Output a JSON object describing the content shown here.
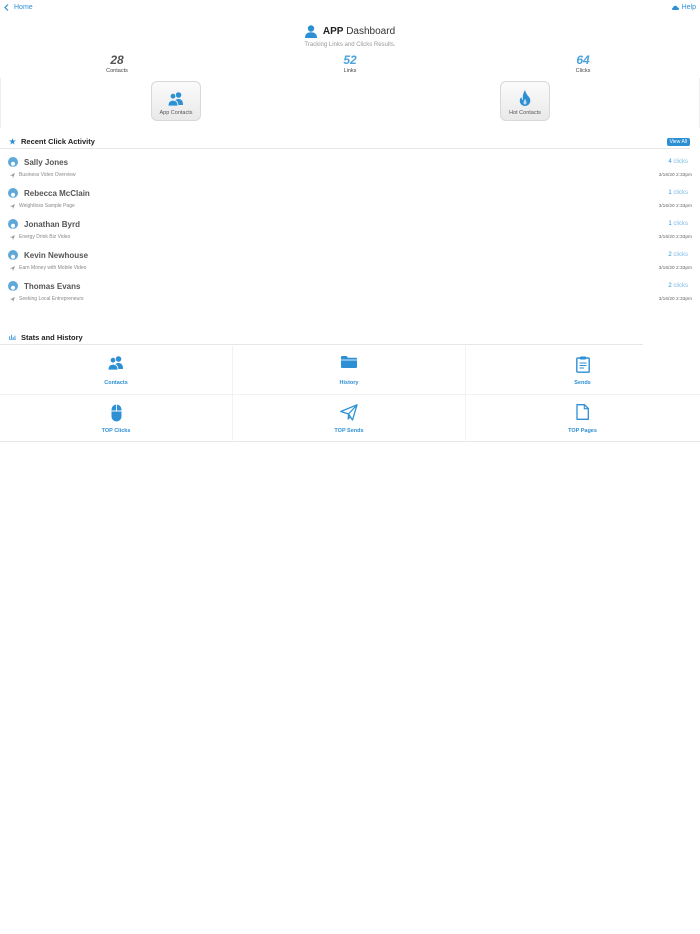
{
  "nav": {
    "home_label": "Home",
    "help_label": "Help"
  },
  "header": {
    "title_strong": "APP",
    "title_rest": "Dashboard",
    "subtitle": "Tracking Links and Clicks Results."
  },
  "counters": [
    {
      "value": "28",
      "label": "Contacts",
      "color": "#555555"
    },
    {
      "value": "52",
      "label": "Links",
      "color": "#4aa3df"
    },
    {
      "value": "64",
      "label": "Clicks",
      "color": "#4aa3df"
    }
  ],
  "quick_buttons": {
    "app_contacts": "App Contacts",
    "hot_contacts": "Hot Contacts"
  },
  "recent": {
    "title": "Recent Click Activity",
    "view_all": "View All",
    "items": [
      {
        "name": "Sally Jones",
        "count": "4",
        "unit": "clicks",
        "page": "Business Video Overview",
        "date": "3/16/20 2:33pm"
      },
      {
        "name": "Rebecca McClain",
        "count": "1",
        "unit": "clicks",
        "page": "Weightloss Sample Page",
        "date": "3/16/20 2:33pm"
      },
      {
        "name": "Jonathan Byrd",
        "count": "1",
        "unit": "clicks",
        "page": "Energy Drink Biz Video",
        "date": "3/16/20 2:33pm"
      },
      {
        "name": "Kevin Newhouse",
        "count": "2",
        "unit": "clicks",
        "page": "Earn Money with Mobile Video",
        "date": "3/16/20 2:33pm"
      },
      {
        "name": "Thomas Evans",
        "count": "2",
        "unit": "clicks",
        "page": "Seeking Local Entrepreneurs",
        "date": "3/16/20 2:33pm"
      }
    ]
  },
  "stats": {
    "title": "Stats and History",
    "cells": [
      {
        "label": "Contacts",
        "icon": "contacts-icon"
      },
      {
        "label": "History",
        "icon": "folder-icon"
      },
      {
        "label": "Sends",
        "icon": "clipboard-icon"
      },
      {
        "label": "TOP Clicks",
        "icon": "mouse-icon"
      },
      {
        "label": "TOP Sends",
        "icon": "paper-plane-icon"
      },
      {
        "label": "TOP Pages",
        "icon": "document-icon"
      }
    ]
  },
  "colors": {
    "accent": "#2d8fd4"
  }
}
